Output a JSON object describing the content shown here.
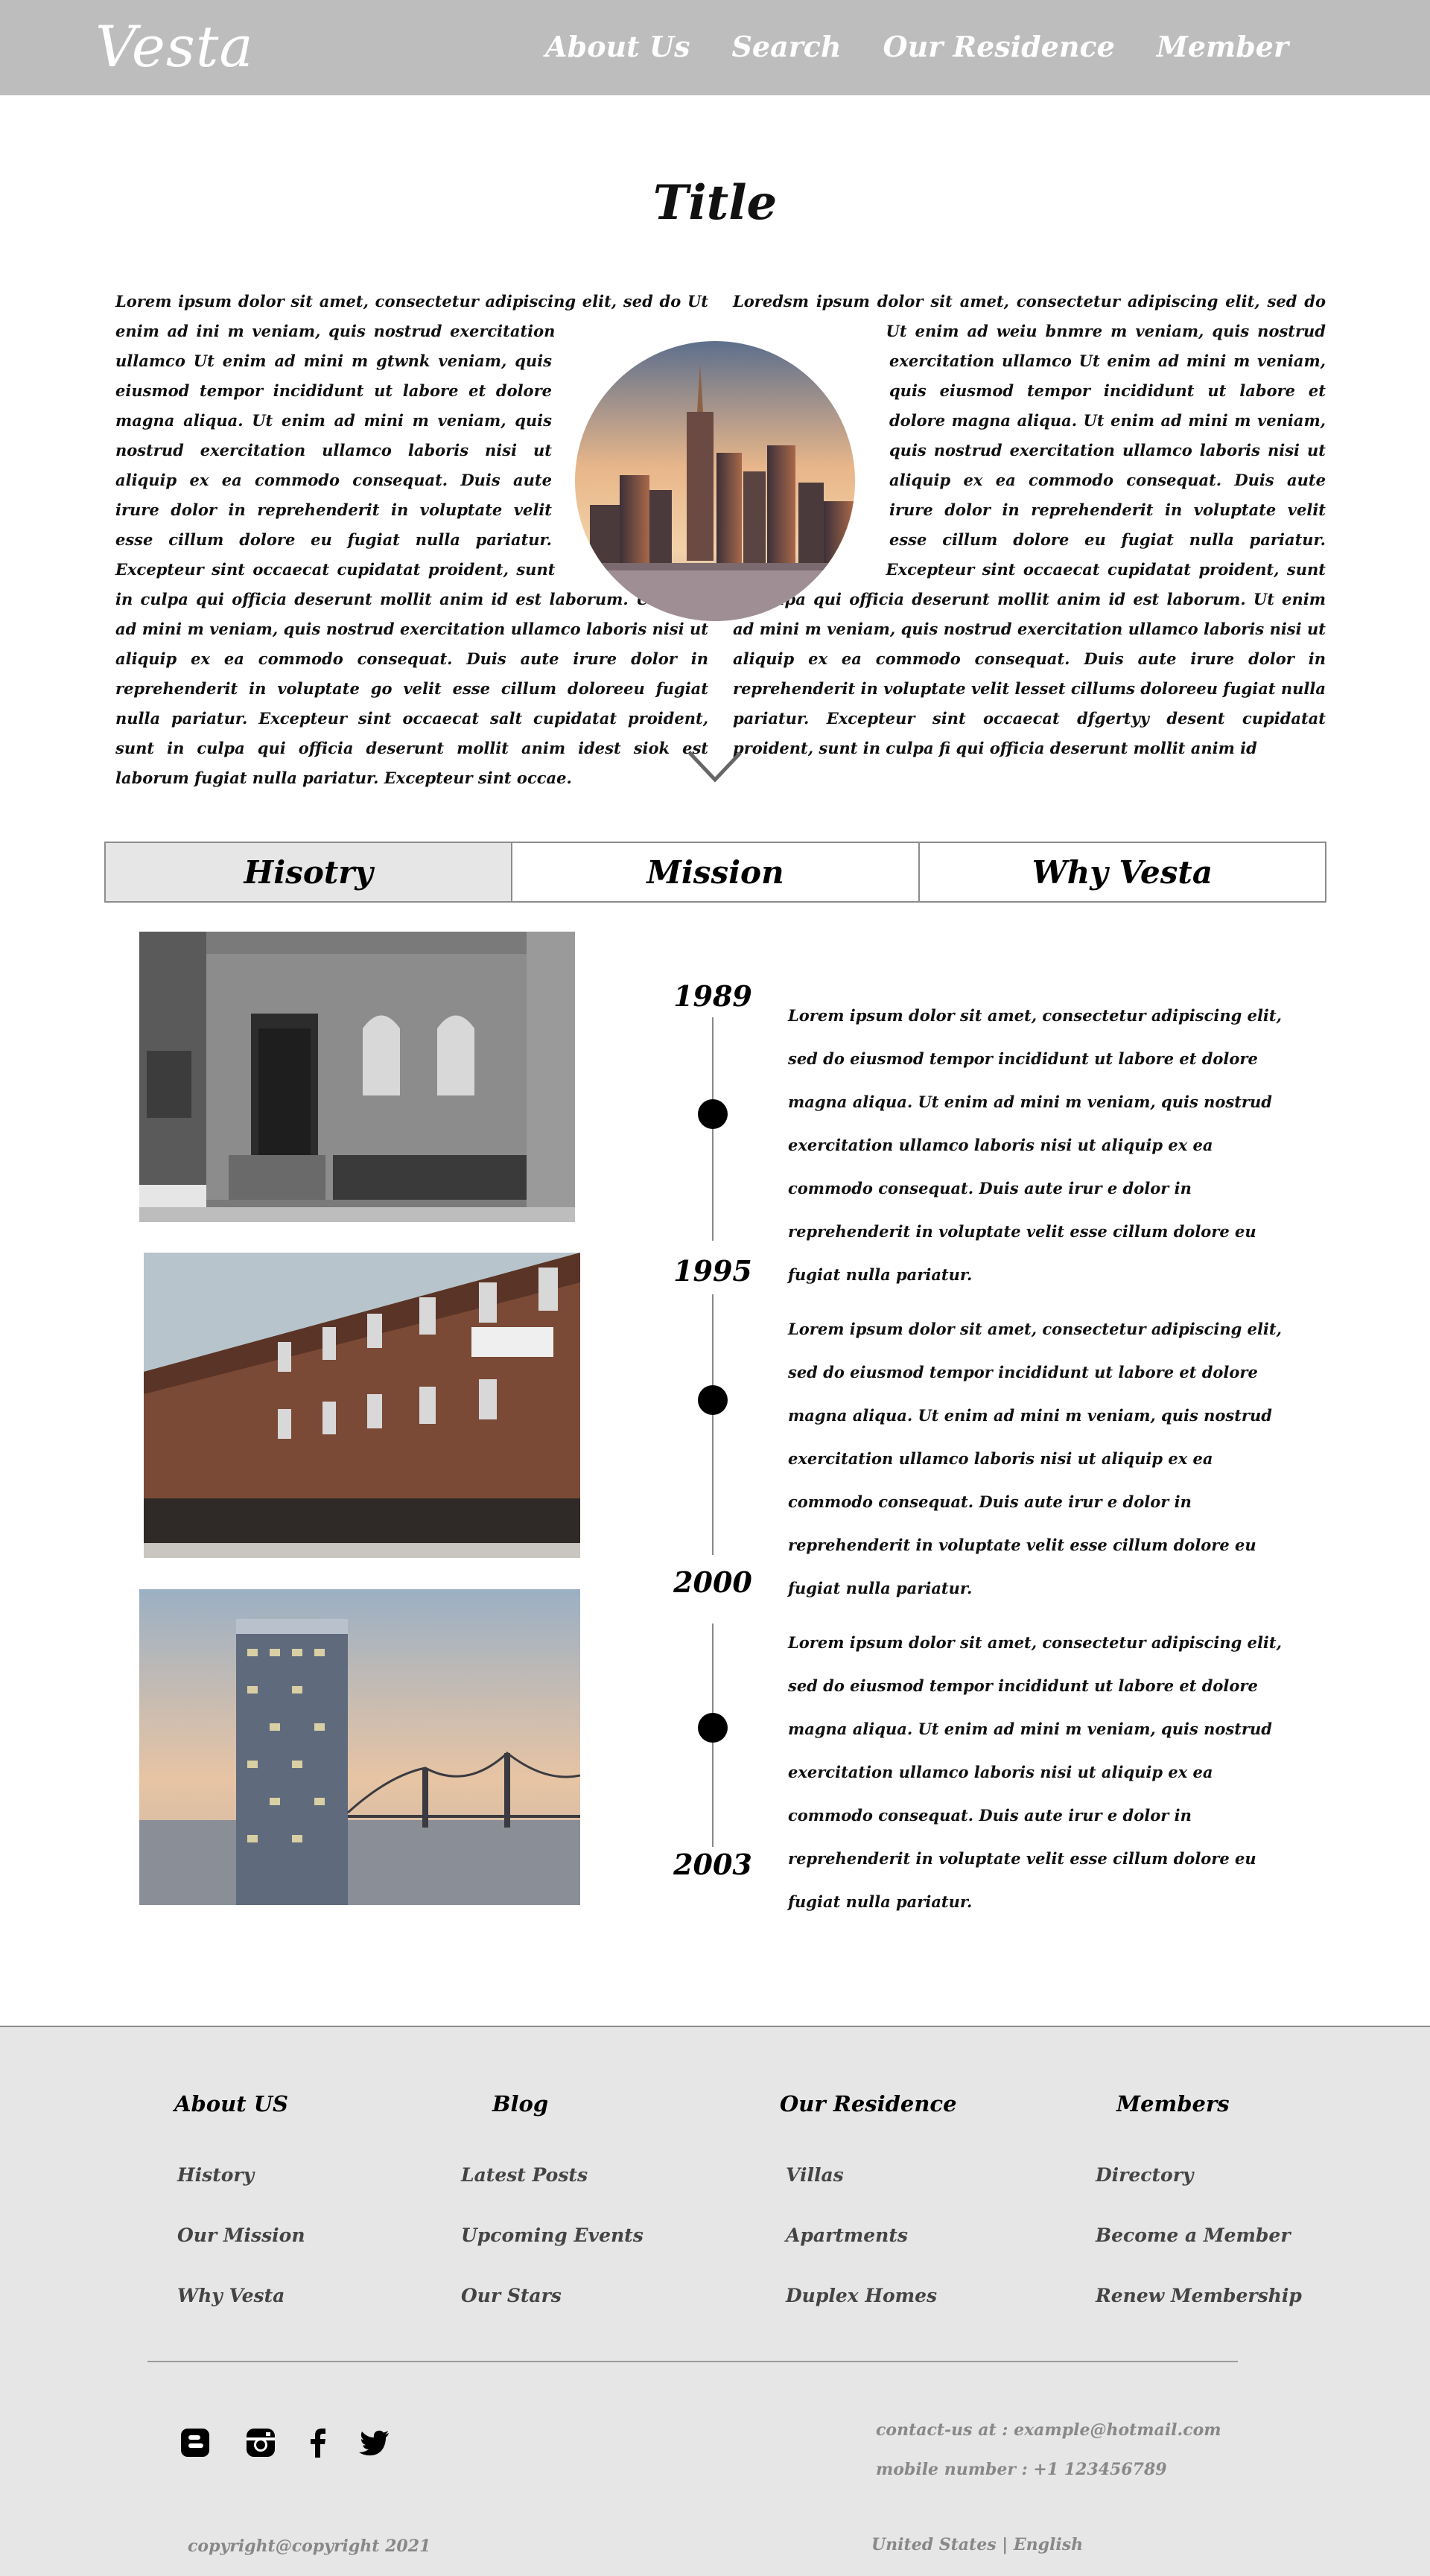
{
  "header": {
    "logo": "Vesta",
    "nav": [
      "About Us",
      "Search",
      "Our Residence",
      "Member"
    ]
  },
  "intro": {
    "title": "Title",
    "left_text": "Lorem ipsum dolor sit amet, consectetur adipiscing elit, sed do Ut enim ad ini m veniam, quis nostrud exercitation ullamco Ut enim ad mini m gtwnk veniam, quis eiusmod tempor incididunt ut labore et dolore magna aliqua. Ut enim ad mini m veniam, quis nostrud exercitation ullamco laboris nisi ut aliquip ex ea commodo consequat. Duis aute irure dolor in reprehenderit in voluptate velit esse cillum dolore eu fugiat nulla pariatur. Excepteur sint occaecat cupidatat proident, sunt in culpa qui officia deserunt mollit anim id est laborum. Ut enim ad mini m veniam, quis nostrud exercitation ullamco laboris nisi ut aliquip ex ea commodo consequat. Duis aute irure dolor in reprehenderit in voluptate go velit esse cillum doloreeu fugiat nulla pariatur. Excepteur sint occaecat salt cupidatat proident, sunt in culpa qui officia deserunt mollit anim idest siok est laborum fugiat nulla pariatur. Excepteur sint occae.",
    "right_text": "Loredsm ipsum dolor sit amet, consectetur adipiscing elit, sed do Ut enim ad weiu bnmre m veniam, quis nostrud exercitation ullamco Ut enim ad mini m veniam, quis eiusmod tempor incididunt ut labore et dolore magna aliqua. Ut enim ad mini m veniam, quis nostrud exercitation ullamco laboris nisi ut aliquip ex ea commodo consequat. Duis aute irure dolor in reprehenderit in voluptate velit esse cillum dolore eu fugiat nulla pariatur. Excepteur sint occaecat cupidatat proident, sunt in culpa qui officia deserunt mollit anim id est laborum. Ut enim ad mini m veniam, quis nostrud exercitation ullamco laboris nisi ut aliquip ex ea commodo consequat. Duis aute irure dolor in reprehenderit in voluptate velit lesset cillums doloreeu fugiat nulla pariatur. Excepteur sint occaecat dfgertyy desent cupidatat proident, sunt in culpa fi qui officia deserunt mollit anim id"
  },
  "tabs": [
    {
      "label": "Hisotry",
      "active": true
    },
    {
      "label": "Mission",
      "active": false
    },
    {
      "label": "Why Vesta",
      "active": false
    }
  ],
  "timeline": {
    "years": [
      "1989",
      "1995",
      "2000",
      "2003"
    ],
    "entries": [
      "Lorem ipsum dolor sit amet, consectetur adipiscing elit, sed do eiusmod tempor incididunt ut labore et dolore magna aliqua. Ut enim ad mini m veniam, quis nostrud exercitation ullamco laboris nisi ut aliquip ex ea commodo consequat. Duis aute irur e dolor in reprehenderit in voluptate velit esse cillum dolore eu fugiat nulla pariatur.",
      "Lorem ipsum dolor sit amet, consectetur adipiscing elit, sed do eiusmod tempor incididunt ut labore et dolore magna aliqua. Ut enim ad mini m veniam, quis nostrud exercitation ullamco laboris nisi ut aliquip ex ea commodo consequat. Duis aute irur e dolor in reprehenderit in voluptate velit esse cillum dolore eu fugiat nulla pariatur.",
      "Lorem ipsum dolor sit amet, consectetur adipiscing elit, sed do eiusmod tempor incididunt ut labore et dolore magna aliqua. Ut enim ad mini m veniam, quis nostrud exercitation ullamco laboris nisi ut aliquip ex ea commodo consequat. Duis aute irur e dolor in reprehenderit in voluptate velit esse cillum dolore eu fugiat nulla pariatur."
    ]
  },
  "footer": {
    "columns": [
      {
        "heading": "About US",
        "links": [
          "History",
          "Our Mission",
          "Why Vesta"
        ]
      },
      {
        "heading": "Blog",
        "links": [
          "Latest Posts",
          "Upcoming Events",
          "Our Stars"
        ]
      },
      {
        "heading": "Our Residence",
        "links": [
          "Villas",
          "Apartments",
          "Duplex Homes"
        ]
      },
      {
        "heading": "Members",
        "links": [
          "Directory",
          "Become a Member",
          "Renew Membership"
        ]
      }
    ],
    "social_icons": [
      "blogger-icon",
      "instagram-icon",
      "facebook-icon",
      "twitter-icon"
    ],
    "contact_email": "contact-us at : example@hotmail.com",
    "contact_phone": "mobile number : +1 123456789",
    "copyright": "copyright@copyright 2021",
    "locale": "United States | English"
  }
}
